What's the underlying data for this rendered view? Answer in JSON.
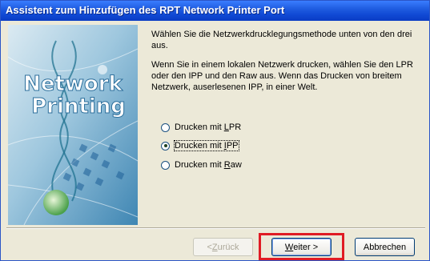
{
  "window": {
    "title": "Assistent zum Hinzufügen des RPT Network Printer Port",
    "titlebar_color": "#1f5ce0"
  },
  "side_image": {
    "line1": "Network",
    "line2": "Printing",
    "accent": "#2a7fbf"
  },
  "content": {
    "paragraph1": "Wählen Sie die Netzwerkdrucklegungsmethode unten von den drei aus.",
    "paragraph2": "Wenn Sie in einem lokalen Netzwerk drucken, wählen Sie den LPR oder den IPP und den Raw aus.  Wenn das Drucken von breitem Netzwerk, auserlesenen IPP, in einer Welt."
  },
  "options": [
    {
      "prefix": "Drucken mit ",
      "accel": "L",
      "suffix": "PR",
      "checked": false
    },
    {
      "prefix": "Drucken mit ",
      "accel": "I",
      "suffix": "PP",
      "checked": true
    },
    {
      "prefix": "Drucken mit ",
      "accel": "R",
      "suffix": "aw",
      "checked": false
    }
  ],
  "buttons": {
    "back": {
      "prefix": "< ",
      "accel": "Z",
      "suffix": "urück",
      "enabled": false
    },
    "next": {
      "accel": "W",
      "suffix": "eiter >"
    },
    "cancel": {
      "label": "Abbrechen"
    }
  },
  "highlight_color": "#e01b24"
}
